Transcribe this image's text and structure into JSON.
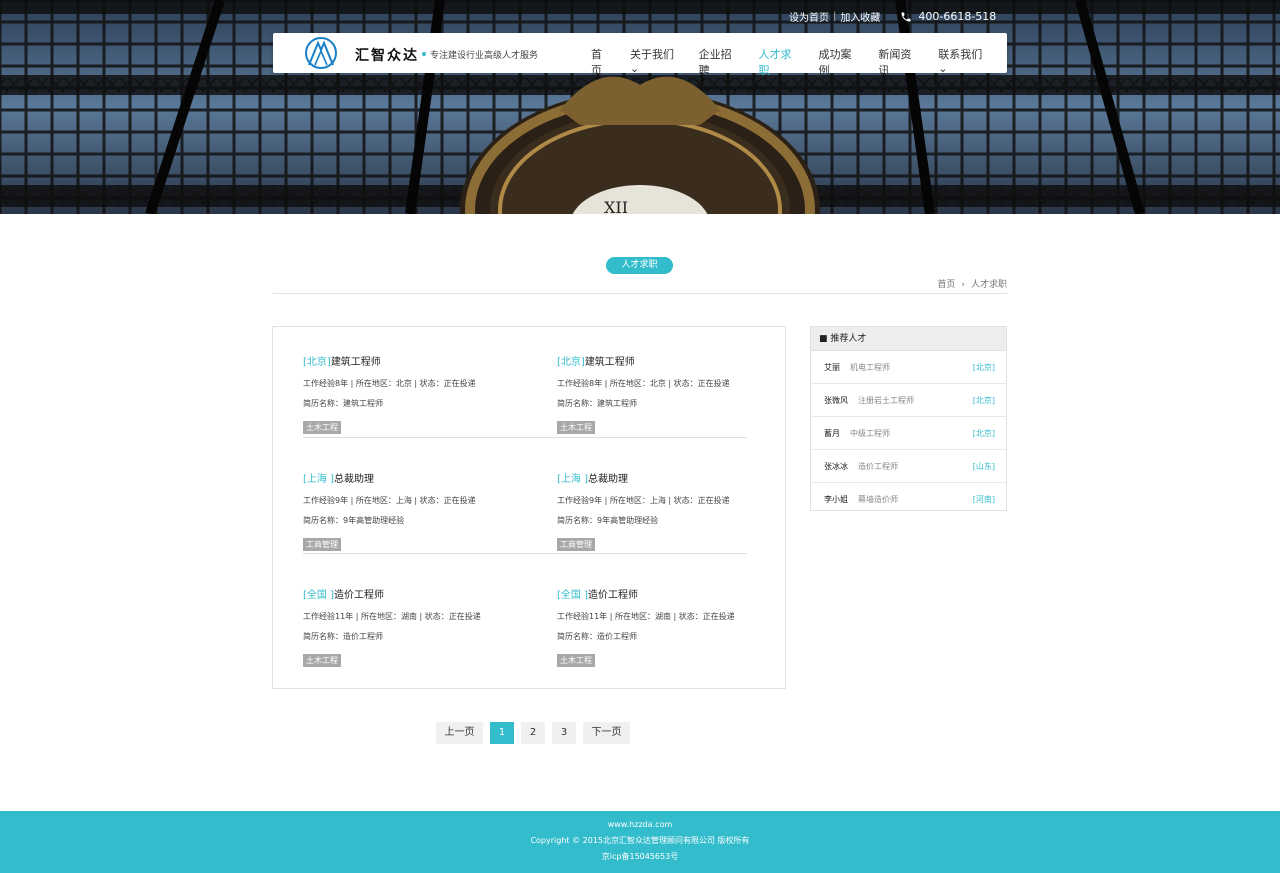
{
  "topbar": {
    "set_home": "设为首页",
    "sep": "|",
    "favorite": "加入收藏",
    "phone": "400-6618-518"
  },
  "brand": {
    "name": "汇智众达",
    "slogan": "专注建设行业高级人才服务"
  },
  "nav": {
    "items": [
      {
        "label": "首页"
      },
      {
        "label": "关于我们⌄"
      },
      {
        "label": "企业招聘"
      },
      {
        "label": "人才求职"
      },
      {
        "label": "成功案例"
      },
      {
        "label": "新闻资讯"
      },
      {
        "label": "联系我们⌄"
      }
    ],
    "active_index": 3
  },
  "section": {
    "title": "人才求职",
    "breadcrumb_home": "首页",
    "breadcrumb_current": "人才求职"
  },
  "cards": [
    {
      "city": "[北京]",
      "title": "建筑工程师",
      "meta": "工作经验8年 | 所在地区：北京 | 状态：正在投递",
      "resume": "简历名称：建筑工程师",
      "tag": "土木工程"
    },
    {
      "city": "[北京]",
      "title": "建筑工程师",
      "meta": "工作经验8年 | 所在地区：北京 | 状态：正在投递",
      "resume": "简历名称：建筑工程师",
      "tag": "土木工程"
    },
    {
      "city": "[上海 ]",
      "title": "总裁助理",
      "meta": "工作经验9年 | 所在地区：上海 | 状态：正在投递",
      "resume": "简历名称：9年高管助理经验",
      "tag": "工商管理"
    },
    {
      "city": "[上海 ]",
      "title": "总裁助理",
      "meta": "工作经验9年 | 所在地区：上海 | 状态：正在投递",
      "resume": "简历名称：9年高管助理经验",
      "tag": "工商管理"
    },
    {
      "city": "[全国 ]",
      "title": "造价工程师",
      "meta": "工作经验11年 | 所在地区：湖南 | 状态：正在投递",
      "resume": "简历名称：造价工程师",
      "tag": "土木工程"
    },
    {
      "city": "[全国 ]",
      "title": "造价工程师",
      "meta": "工作经验11年 | 所在地区：湖南 | 状态：正在投递",
      "resume": "简历名称：造价工程师",
      "tag": "土木工程"
    }
  ],
  "sidebar": {
    "title": "■ 推荐人才",
    "items": [
      {
        "name": "艾丽",
        "job": "机电工程师",
        "loc": "[北京]"
      },
      {
        "name": "张微风",
        "job": "注册岩土工程师",
        "loc": "[北京]"
      },
      {
        "name": "蓄月",
        "job": "中级工程师",
        "loc": "[北京]"
      },
      {
        "name": "张冰冰",
        "job": "造价工程师",
        "loc": "[山东]"
      },
      {
        "name": "李小姐",
        "job": "幕墙造价师",
        "loc": "[河南]"
      }
    ]
  },
  "pager": {
    "prev": "上一页",
    "pages": [
      "1",
      "2",
      "3"
    ],
    "next": "下一页"
  },
  "footer": {
    "site": "www.hzzda.com",
    "copyright": "Copyright © 2015北京汇智众达管理顾问有限公司 版权所有",
    "icp": "京icp备15045653号"
  },
  "colors": {
    "accent": "#32bccc",
    "tag_gray": "#a8a8a8"
  }
}
